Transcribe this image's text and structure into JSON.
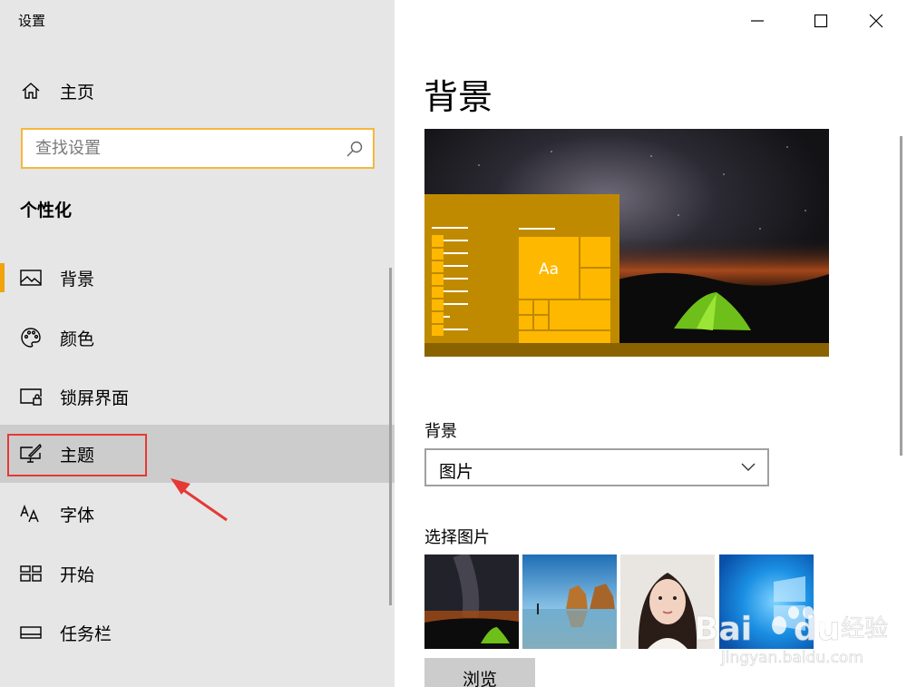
{
  "window": {
    "title": "设置"
  },
  "sidebar": {
    "home_label": "主页",
    "search_placeholder": "查找设置",
    "section_title": "个性化",
    "items": [
      {
        "label": "背景",
        "icon": "picture-icon"
      },
      {
        "label": "颜色",
        "icon": "palette-icon"
      },
      {
        "label": "锁屏界面",
        "icon": "lock-screen-icon"
      },
      {
        "label": "主题",
        "icon": "theme-brush-icon"
      },
      {
        "label": "字体",
        "icon": "font-icon"
      },
      {
        "label": "开始",
        "icon": "start-icon"
      },
      {
        "label": "任务栏",
        "icon": "taskbar-icon"
      }
    ]
  },
  "main": {
    "page_title": "背景",
    "preview_sample_text": "Aa",
    "background_label": "背景",
    "background_value": "图片",
    "choose_picture_label": "选择图片",
    "browse_label": "浏览"
  },
  "watermark": {
    "brand": "Bai",
    "brand2": "du",
    "cn": "经验",
    "url": "jingyan.baidu.com"
  },
  "colors": {
    "accent": "#f0a30a",
    "highlight_red": "#e53935",
    "search_border": "#f6b73c"
  }
}
